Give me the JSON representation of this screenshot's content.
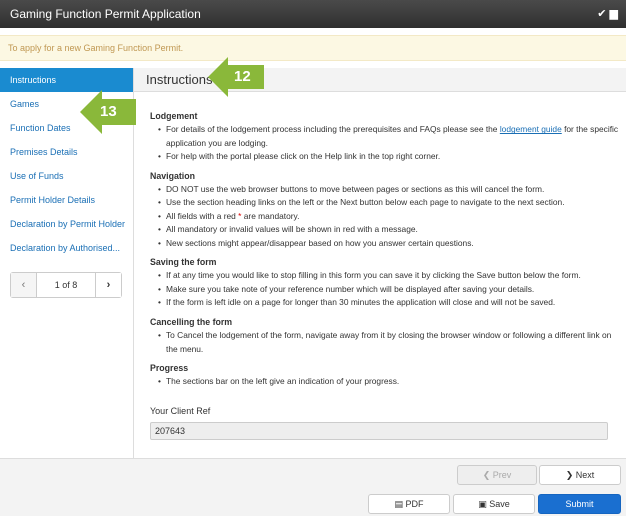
{
  "window": {
    "title": "Gaming Function Permit Application"
  },
  "banner": {
    "text": "To apply for a new Gaming Function Permit."
  },
  "sidebar": {
    "items": [
      {
        "label": "Instructions"
      },
      {
        "label": "Games"
      },
      {
        "label": "Function Dates"
      },
      {
        "label": "Premises Details"
      },
      {
        "label": "Use of Funds"
      },
      {
        "label": "Permit Holder Details"
      },
      {
        "label": "Declaration by Permit Holder"
      },
      {
        "label": "Declaration by Authorised..."
      }
    ],
    "pager": {
      "text": "1 of 8"
    }
  },
  "main": {
    "heading": "Instructions",
    "sections": [
      {
        "title": "Lodgement"
      },
      {
        "title": "Navigation"
      },
      {
        "title": "Saving the form"
      },
      {
        "title": "Cancelling the form"
      },
      {
        "title": "Progress"
      }
    ],
    "lodgement": {
      "b1_pre": "For details of the lodgement process including the prerequisites and FAQs please see the ",
      "b1_link": "lodgement guide",
      "b1_post": " for the specific application you are lodging.",
      "b2": "For help with the portal please click on the Help link in the top right corner."
    },
    "navigation": {
      "b1": "DO NOT use the web browser buttons to move between pages or sections as this will cancel the form.",
      "b2": "Use the section heading links on the left or the Next button below each page to navigate to the next section.",
      "b3_pre": "All fields with a red ",
      "b3_star": "*",
      "b3_post": " are mandatory.",
      "b4": "All mandatory or invalid values will be shown in red with a message.",
      "b5": "New sections might appear/disappear based on how you answer certain questions."
    },
    "saving": {
      "b1": "If at any time you would like to stop filling in this form you can save it by clicking the Save button below the form.",
      "b2": "Make sure you take note of your reference number which will be displayed after saving your details.",
      "b3": "If the form is left idle on a page for longer than 30 minutes the application will close and will not be saved."
    },
    "cancelling": {
      "b1": "To Cancel the lodgement of the form, navigate away from it by closing the browser window or following a different link on the menu."
    },
    "progress": {
      "b1": "The sections bar on the left give an indication of your progress."
    },
    "client_ref": {
      "label": "Your Client Ref",
      "value": "207643"
    }
  },
  "footer": {
    "prev_label": "Prev",
    "next_label": "Next",
    "pdf_label": "PDF",
    "save_label": "Save",
    "submit_label": "Submit"
  },
  "callouts": {
    "a": "12",
    "b": "13"
  },
  "colors": {
    "accent": "#1a8bd0",
    "callout": "#8ab83a",
    "primary_button": "#1a6fd0"
  }
}
